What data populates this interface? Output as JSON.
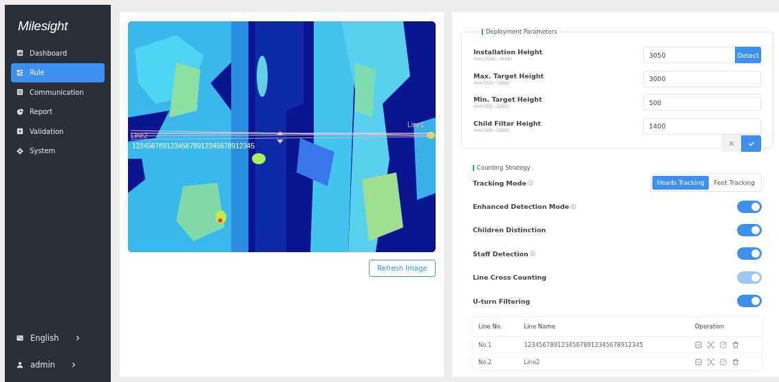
{
  "sidebar": {
    "logo": "Milesight",
    "items": [
      {
        "label": "Dashboard",
        "selected": false
      },
      {
        "label": "Rule",
        "selected": true
      },
      {
        "label": "Communication",
        "selected": false
      },
      {
        "label": "Report",
        "selected": false
      },
      {
        "label": "Validation",
        "selected": false
      },
      {
        "label": "System",
        "selected": false
      }
    ],
    "footer": [
      {
        "label": "English"
      },
      {
        "label": "admin"
      }
    ]
  },
  "preview": {
    "lines": [
      {
        "label": "Line2",
        "caption": "12345678912345678912345678912345"
      },
      {
        "label": "Line1"
      }
    ],
    "refresh_button": "Refresh Image"
  },
  "deployment": {
    "title": "Deployment Parameters",
    "fields": [
      {
        "label": "Installation Height",
        "hint": "mm(2000~3500)",
        "value": "3050",
        "button": "Detect"
      },
      {
        "label": "Max. Target Height",
        "hint": "mm(500~3000)",
        "value": "3000"
      },
      {
        "label": "Min. Target Height",
        "hint": "mm(500~3000)",
        "value": "500"
      },
      {
        "label": "Child Filter Height",
        "hint": "mm(500~3000)",
        "value": "1400"
      }
    ]
  },
  "counting": {
    "title": "Counting Strategy",
    "rows": [
      {
        "kind": "segmented",
        "label": "Tracking Mode",
        "info": true,
        "options": [
          {
            "label": "Heads Tracking",
            "selected": true
          },
          {
            "label": "Feet Tracking",
            "selected": false
          }
        ]
      },
      {
        "kind": "toggle",
        "label": "Enhanced Detection Mode",
        "info": true,
        "on": true,
        "disabled": false
      },
      {
        "kind": "toggle",
        "label": "Children Distinction",
        "info": false,
        "on": true,
        "disabled": false
      },
      {
        "kind": "toggle",
        "label": "Staff Detection",
        "info": true,
        "on": true,
        "disabled": false
      },
      {
        "kind": "toggle",
        "label": "Line Cross Counting",
        "info": false,
        "on": true,
        "disabled": true
      },
      {
        "kind": "toggle",
        "label": "U-turn Filtering",
        "info": false,
        "on": true,
        "disabled": false
      }
    ]
  },
  "table": {
    "columns": [
      "Line No.",
      "Line Name",
      "Operation"
    ],
    "rows": [
      {
        "number": "No.1",
        "name": "12345678912345678912345678912345"
      },
      {
        "number": "No.2",
        "name": "Line2"
      }
    ]
  }
}
